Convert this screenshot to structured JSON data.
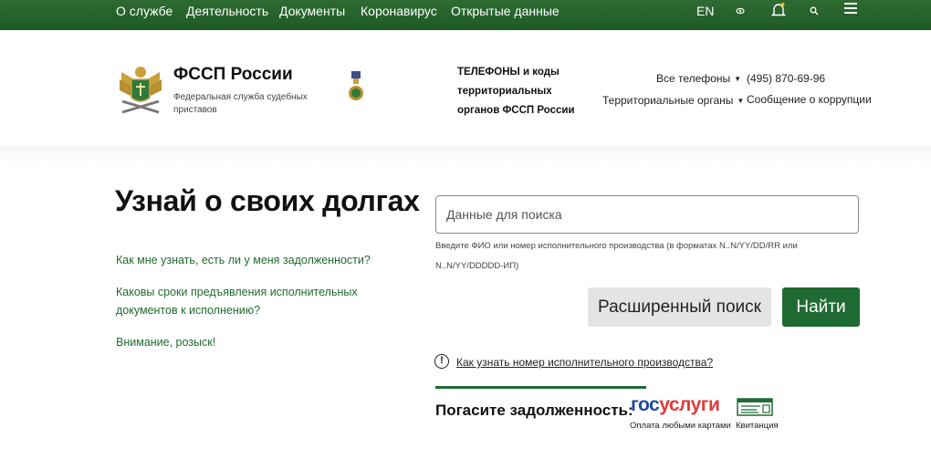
{
  "topnav": {
    "items": [
      "О службе",
      "Деятельность",
      "Документы",
      "Коронавирус",
      "Открытые данные"
    ],
    "lang": "EN",
    "icons": [
      "eye-icon",
      "bell-icon",
      "search-icon",
      "menu-icon"
    ],
    "accent": "#216029"
  },
  "header": {
    "brand_title": "ФССП России",
    "brand_subtitle": "Федеральная служба судебных приставов",
    "phones_title": "ТЕЛЕФОНЫ и коды территориальных органов ФССП России",
    "all_phones": "Все телефоны",
    "territorial": "Территориальные органы",
    "phone": "(495) 870-69-96",
    "corruption": "Сообщение о коррупции"
  },
  "main": {
    "heading": "Узнай о своих долгах",
    "links": [
      "Как мне узнать, есть ли у меня задолженности?",
      "Каковы сроки предъявления исполнительных документов к исполнению?",
      "Внимание, розыск!"
    ],
    "search": {
      "placeholder": "Данные для поиска",
      "hint": "Введите ФИО или номер исполнительного производства (в форматах N..N/YY/DD/RR или N..N/YY/DDDDD-ИП)",
      "advanced_label": "Расширенный поиск",
      "submit_label": "Найти"
    },
    "info_link": "Как узнать номер исполнительного производства?",
    "pay": {
      "label": "Погасите задолженность:",
      "gos_part1": "гос",
      "gos_part2": "услуги",
      "gos_caption": "Оплата любыми картами",
      "receipt_caption": "Квитанция"
    },
    "colors": {
      "green": "#1f6b33",
      "gos_blue": "#1d4aa0",
      "gos_red": "#e23a3a"
    }
  }
}
